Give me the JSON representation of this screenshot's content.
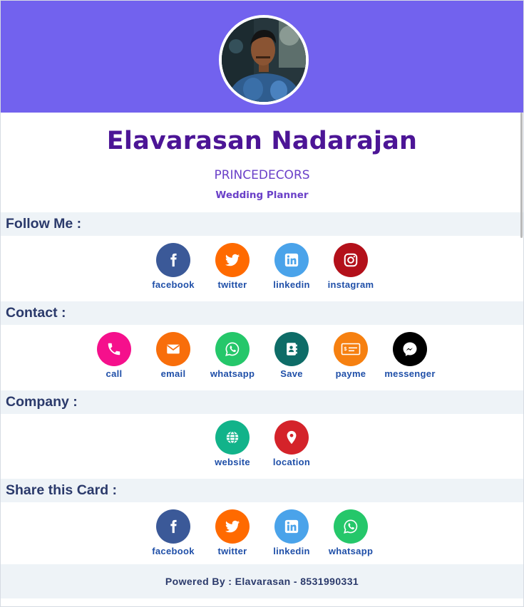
{
  "profile": {
    "name": "Elavarasan Nadarajan",
    "company": "PRINCEDECORS",
    "role": "Wedding Planner"
  },
  "sections": {
    "follow": {
      "title": "Follow Me :",
      "items": [
        {
          "label": "facebook",
          "icon": "facebook-icon",
          "color": "#3b5998"
        },
        {
          "label": "twitter",
          "icon": "twitter-icon",
          "color": "#ff6a00"
        },
        {
          "label": "linkedin",
          "icon": "linkedin-icon",
          "color": "#4aa3ea"
        },
        {
          "label": "instagram",
          "icon": "instagram-icon",
          "color": "#b3101a"
        }
      ]
    },
    "contact": {
      "title": "Contact :",
      "items": [
        {
          "label": "call",
          "icon": "phone-icon",
          "color": "#f5108c"
        },
        {
          "label": "email",
          "icon": "envelope-icon",
          "color": "#f86e0b"
        },
        {
          "label": "whatsapp",
          "icon": "whatsapp-icon",
          "color": "#25c76a"
        },
        {
          "label": "Save",
          "icon": "address-book-icon",
          "color": "#0e6c67"
        },
        {
          "label": "payme",
          "icon": "cheque-icon",
          "color": "#f68010"
        },
        {
          "label": "messenger",
          "icon": "messenger-icon",
          "color": "#000000"
        }
      ]
    },
    "company": {
      "title": "Company :",
      "items": [
        {
          "label": "website",
          "icon": "globe-icon",
          "color": "#12b38a"
        },
        {
          "label": "location",
          "icon": "map-pin-icon",
          "color": "#d4232a"
        }
      ]
    },
    "share": {
      "title": "Share this Card :",
      "items": [
        {
          "label": "facebook",
          "icon": "facebook-icon",
          "color": "#3b5998"
        },
        {
          "label": "twitter",
          "icon": "twitter-icon",
          "color": "#ff6a00"
        },
        {
          "label": "linkedin",
          "icon": "linkedin-icon",
          "color": "#4aa3ea"
        },
        {
          "label": "whatsapp",
          "icon": "whatsapp-icon",
          "color": "#25c76a"
        }
      ]
    }
  },
  "footer": {
    "text": "Powered By : Elavarasan - 8531990331"
  },
  "colors": {
    "banner": "#7262ee",
    "name": "#4c1596",
    "subtitle": "#6a40c8",
    "section_bg": "#eef3f7",
    "section_title": "#2b3a6b",
    "icon_label": "#1f4fa8"
  }
}
